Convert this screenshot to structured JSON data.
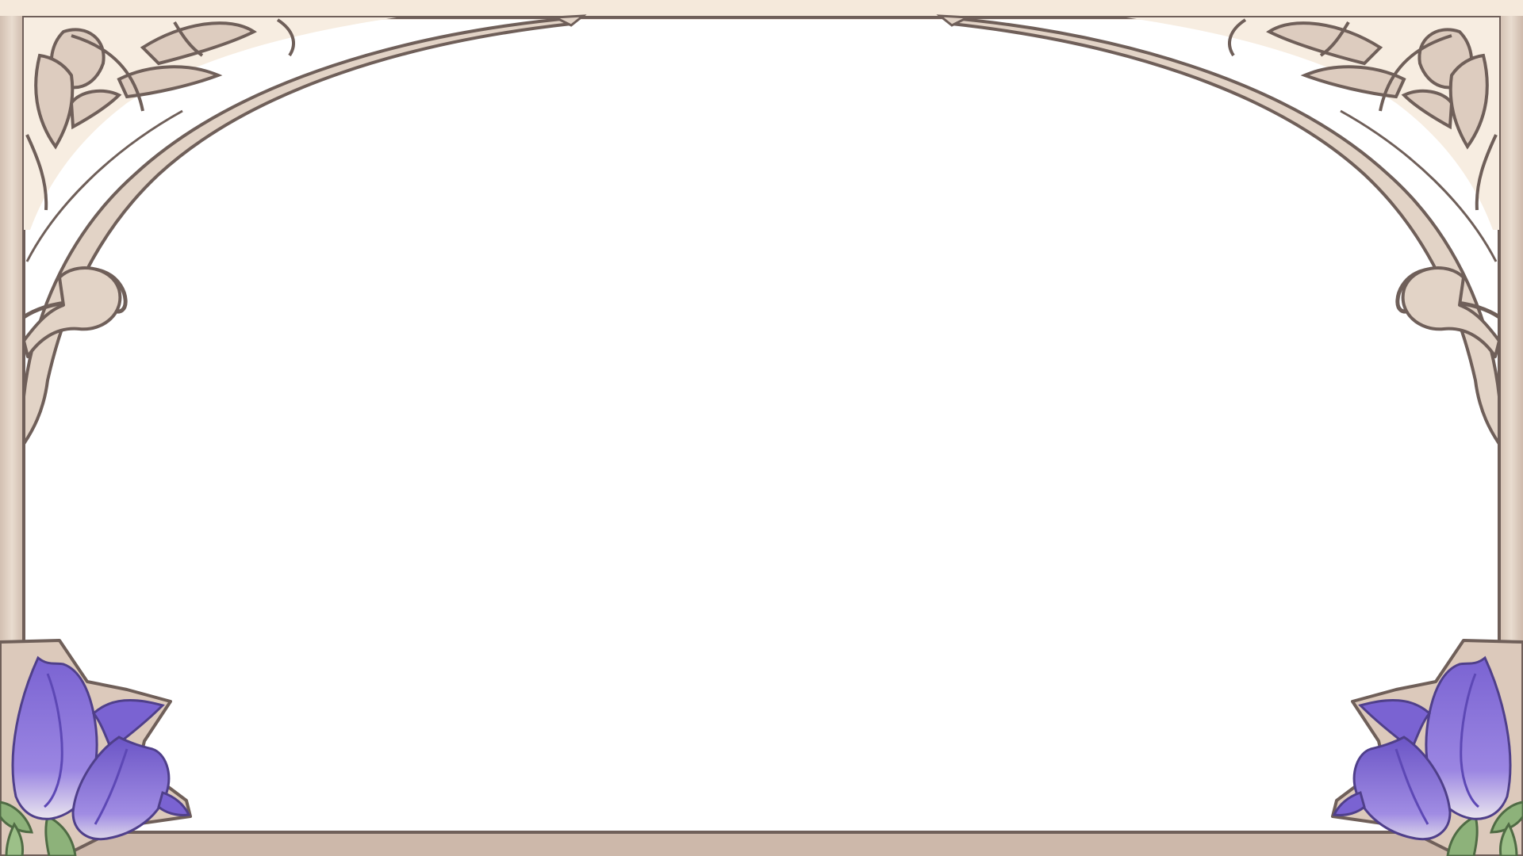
{
  "frame": {
    "style": "art-nouveau-ornamental-border",
    "colors": {
      "frame_fill": "#e2d3c6",
      "frame_light": "#f3e8dc",
      "frame_shadow": "#c9b6a8",
      "outline": "#6f5f59",
      "leaf_fill": "#d9c8ba",
      "corner_bg": "#f7ede1",
      "flower_light": "#a893e6",
      "flower_dark": "#6f59c9",
      "flower_tip": "#e9e4ef",
      "leaf_green": "#8db27a",
      "interior": "#ffffff"
    },
    "icons": {
      "top_left": "scroll-leaf-ornament-icon",
      "top_right": "scroll-leaf-ornament-icon",
      "bottom_left": "purple-tulip-flowers-icon",
      "bottom_right": "purple-tulip-flowers-icon"
    }
  }
}
